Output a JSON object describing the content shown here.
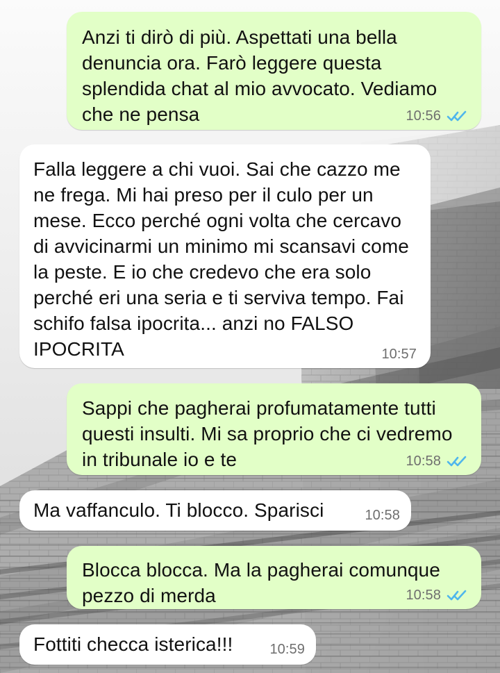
{
  "chat": {
    "accent_out": "#e2ffc7",
    "accent_in": "#ffffff",
    "read_tick_color": "#4fb6ec",
    "messages": [
      {
        "text": "Anzi ti dirò di più. Aspettati una bella denuncia ora. Farò leggere questa splendida chat al mio avvocato. Vediamo che ne pensa",
        "time": "10:56",
        "direction": "out",
        "status": "read",
        "icon": "double-check-icon"
      },
      {
        "text": "Falla leggere a chi vuoi. Sai che cazzo me ne frega. Mi hai preso per il culo per un mese. Ecco perché ogni volta che cercavo di avvicinarmi un minimo mi scansavi come la peste. E io che credevo che era solo perché eri una seria e ti serviva tempo. Fai schifo falsa ipocrita... anzi no FALSO IPOCRITA",
        "time": "10:57",
        "direction": "in"
      },
      {
        "text": "Sappi che pagherai profumatamente tutti questi insulti. Mi sa proprio che ci vedremo in tribunale io e te",
        "time": "10:58",
        "direction": "out",
        "status": "read",
        "icon": "double-check-icon"
      },
      {
        "text": "Ma vaffanculo. Ti blocco. Sparisci",
        "time": "10:58",
        "direction": "in"
      },
      {
        "text": "Blocca blocca. Ma la pagherai comunque pezzo di merda",
        "time": "10:58",
        "direction": "out",
        "status": "read",
        "icon": "double-check-icon"
      },
      {
        "text": "Fottiti checca isterica!!!",
        "time": "10:59",
        "direction": "in"
      }
    ]
  }
}
